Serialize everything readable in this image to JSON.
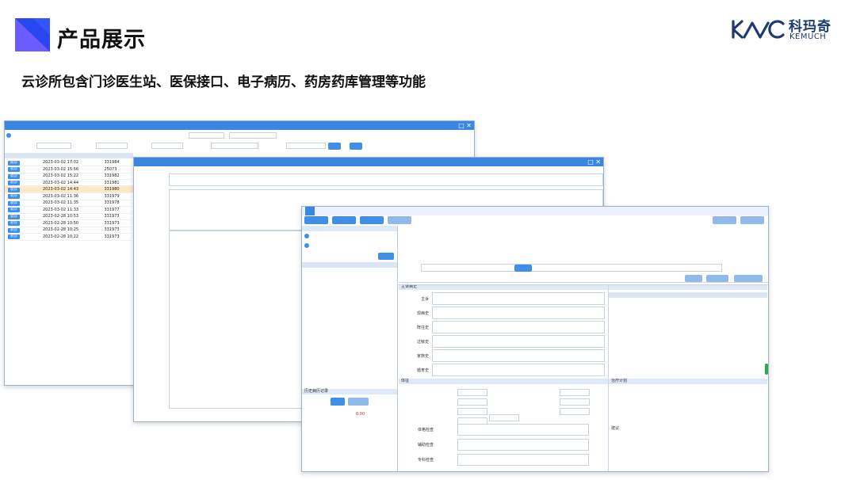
{
  "slide": {
    "title": "产品展示",
    "subtitle": "云诊所包含门诊医生站、医保接口、电子病历、药房药库管理等功能",
    "logo_cn": "科玛奇",
    "logo_en": "KEMUCH"
  },
  "colors": {
    "accent": "#3f8fe8",
    "title_mark": "#3355ff",
    "brand": "#1d3b72"
  },
  "win1": {
    "rows": [
      {
        "op": "就诊",
        "date": "2023-03-02 17:02",
        "no": "331984"
      },
      {
        "op": "就诊",
        "date": "2023-03-02 15:56",
        "no": "25073"
      },
      {
        "op": "就诊",
        "date": "2023-03-02 15:22",
        "no": "331982"
      },
      {
        "op": "就诊",
        "date": "2023-03-02 14:44",
        "no": "331981"
      },
      {
        "op": "就诊",
        "date": "2023-03-02 14:43",
        "no": "331980"
      },
      {
        "op": "就诊",
        "date": "2023-03-02 11:36",
        "no": "331979"
      },
      {
        "op": "就诊",
        "date": "2023-03-02 11:35",
        "no": "331978"
      },
      {
        "op": "就诊",
        "date": "2023-03-02 11:33",
        "no": "331977"
      },
      {
        "op": "就诊",
        "date": "2023-02-28 10:53",
        "no": "331973"
      },
      {
        "op": "就诊",
        "date": "2023-02-28 10:50",
        "no": "331973"
      },
      {
        "op": "就诊",
        "date": "2023-02-28 10:25",
        "no": "331973"
      },
      {
        "op": "就诊",
        "date": "2023-02-28 10:22",
        "no": "331973"
      }
    ]
  },
  "win3": {
    "sections": {
      "history_main": "主诉病史",
      "vitals": "体征",
      "treatment": "治疗计划",
      "record_list": "历史病历记录"
    },
    "history_rows": [
      {
        "label": "主诉"
      },
      {
        "label": "现病史"
      },
      {
        "label": "既往史"
      },
      {
        "label": "过敏史"
      },
      {
        "label": "家族史"
      },
      {
        "label": "婚育史"
      }
    ],
    "exam_rows": [
      {
        "label": "体格检查"
      },
      {
        "label": "辅助检查"
      },
      {
        "label": "专科检查"
      }
    ],
    "suggest_label": "建议",
    "amount": "0.00"
  }
}
